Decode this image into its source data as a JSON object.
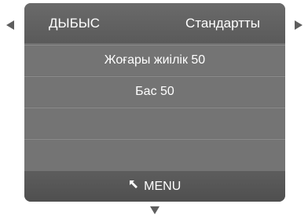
{
  "nav": {
    "left_icon": "triangle-left-icon",
    "right_icon": "triangle-right-icon",
    "down_icon": "triangle-down-icon"
  },
  "header": {
    "title": "ДЫБЫС",
    "value": "Стандартты"
  },
  "menu_items": [
    {
      "label": "Жоғары жиілік  50"
    },
    {
      "label": "Бас 50"
    },
    {
      "label": ""
    },
    {
      "label": ""
    }
  ],
  "footer": {
    "icon": "return-arrow-icon",
    "label": "MENU"
  },
  "colors": {
    "panel_bg": "#747474",
    "header_bg": "#5f5f5f",
    "footer_bg": "#525252",
    "text": "#ffffff",
    "arrow": "#5e5e5e"
  }
}
